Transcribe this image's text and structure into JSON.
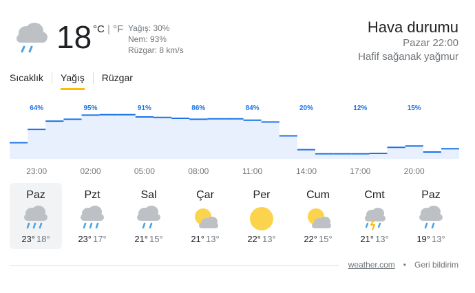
{
  "current": {
    "temperature": "18",
    "unit_c": "°C",
    "unit_f": "°F",
    "precipitation": "Yağış: 30%",
    "humidity": "Nem: 93%",
    "wind": "Rüzgar: 8 km/s",
    "icon": "rain-cloud-icon"
  },
  "header": {
    "title": "Hava durumu",
    "datetime": "Pazar 22:00",
    "condition": "Hafif sağanak yağmur"
  },
  "tabs": [
    {
      "label": "Sıcaklık",
      "active": false
    },
    {
      "label": "Yağış",
      "active": true
    },
    {
      "label": "Rüzgar",
      "active": false
    }
  ],
  "chart_data": {
    "type": "area",
    "series": [
      {
        "values": [
          35,
          64,
          82,
          86,
          95,
          96,
          96,
          91,
          90,
          88,
          86,
          87,
          87,
          84,
          80,
          50,
          20,
          11,
          11,
          11,
          12,
          25,
          28,
          15,
          22
        ]
      }
    ],
    "value_labels": [
      "64%",
      "95%",
      "91%",
      "86%",
      "84%",
      "20%",
      "12%",
      "15%"
    ],
    "value_label_indices": [
      1,
      4,
      7,
      10,
      13,
      16,
      19,
      22
    ],
    "x_tick_labels": [
      "23:00",
      "02:00",
      "05:00",
      "08:00",
      "11:00",
      "14:00",
      "17:00",
      "20:00"
    ],
    "ylim": [
      0,
      100
    ],
    "colors": {
      "fill": "#e8f0fe",
      "line": "#1a73e8",
      "label": "#1a73e8",
      "tick": "#70757a"
    }
  },
  "days": [
    {
      "name": "Paz",
      "hi": "23°",
      "lo": "18°",
      "icon": "heavy-rain-icon",
      "selected": true
    },
    {
      "name": "Pzt",
      "hi": "23°",
      "lo": "17°",
      "icon": "heavy-rain-icon",
      "selected": false
    },
    {
      "name": "Sal",
      "hi": "21°",
      "lo": "15°",
      "icon": "rain-icon",
      "selected": false
    },
    {
      "name": "Çar",
      "hi": "21°",
      "lo": "13°",
      "icon": "partly-cloudy-icon",
      "selected": false
    },
    {
      "name": "Per",
      "hi": "22°",
      "lo": "13°",
      "icon": "sun-icon",
      "selected": false
    },
    {
      "name": "Cum",
      "hi": "22°",
      "lo": "15°",
      "icon": "partly-cloudy-icon",
      "selected": false
    },
    {
      "name": "Cmt",
      "hi": "21°",
      "lo": "13°",
      "icon": "thunderstorm-icon",
      "selected": false
    },
    {
      "name": "Paz",
      "hi": "19°",
      "lo": "13°",
      "icon": "rain-icon",
      "selected": false
    }
  ],
  "footer": {
    "source": "weather.com",
    "separator": "•",
    "feedback": "Geri bildirim"
  }
}
